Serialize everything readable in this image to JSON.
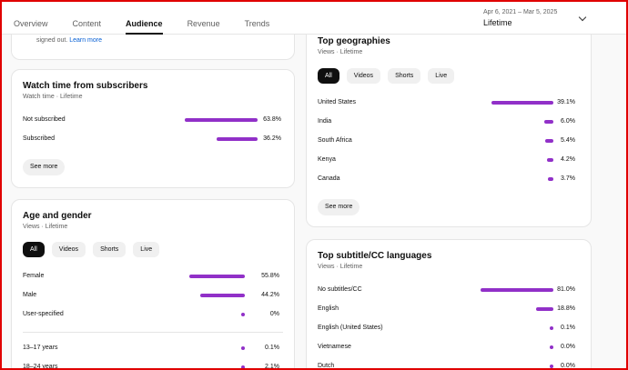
{
  "header": {
    "tabs": [
      "Overview",
      "Content",
      "Audience",
      "Revenue",
      "Trends"
    ],
    "active_tab": "Audience",
    "date_range": "Apr 6, 2021 – Mar 5, 2025",
    "range_label": "Lifetime"
  },
  "top_partial": {
    "text": "signed out.",
    "link": "Learn more"
  },
  "watch_time": {
    "title": "Watch time from subscribers",
    "subtitle": "Watch time · Lifetime",
    "rows": [
      {
        "label": "Not subscribed",
        "value": "63.8%",
        "fraction": 0.638
      },
      {
        "label": "Subscribed",
        "value": "36.2%",
        "fraction": 0.362
      }
    ],
    "see_more": "See more"
  },
  "age_gender": {
    "title": "Age and gender",
    "subtitle": "Views · Lifetime",
    "filters": [
      "All",
      "Videos",
      "Shorts",
      "Live"
    ],
    "active_filter": "All",
    "gender_rows": [
      {
        "label": "Female",
        "value": "55.8%",
        "fraction": 0.558
      },
      {
        "label": "Male",
        "value": "44.2%",
        "fraction": 0.442
      },
      {
        "label": "User-specified",
        "value": "0%",
        "fraction": 0.0
      }
    ],
    "age_rows": [
      {
        "label": "13–17 years",
        "value": "0.1%",
        "fraction": 0.001
      },
      {
        "label": "18–24 years",
        "value": "2.1%",
        "fraction": 0.021
      }
    ]
  },
  "geographies": {
    "title": "Top geographies",
    "subtitle": "Views · Lifetime",
    "filters": [
      "All",
      "Videos",
      "Shorts",
      "Live"
    ],
    "active_filter": "All",
    "rows": [
      {
        "label": "United States",
        "value": "39.1%",
        "fraction": 0.391
      },
      {
        "label": "India",
        "value": "6.0%",
        "fraction": 0.06
      },
      {
        "label": "South Africa",
        "value": "5.4%",
        "fraction": 0.054
      },
      {
        "label": "Kenya",
        "value": "4.2%",
        "fraction": 0.042
      },
      {
        "label": "Canada",
        "value": "3.7%",
        "fraction": 0.037
      }
    ],
    "see_more": "See more"
  },
  "subtitles": {
    "title": "Top subtitle/CC languages",
    "subtitle": "Views · Lifetime",
    "rows": [
      {
        "label": "No subtitles/CC",
        "value": "81.0%",
        "fraction": 0.81
      },
      {
        "label": "English",
        "value": "18.8%",
        "fraction": 0.188
      },
      {
        "label": "English (United States)",
        "value": "0.1%",
        "fraction": 0.001
      },
      {
        "label": "Vietnamese",
        "value": "0.0%",
        "fraction": 0.0
      },
      {
        "label": "Dutch",
        "value": "0.0%",
        "fraction": 0.0
      }
    ]
  },
  "colors": {
    "bar": "#9130c8",
    "link": "#065fd4",
    "frame": "#e00000"
  }
}
